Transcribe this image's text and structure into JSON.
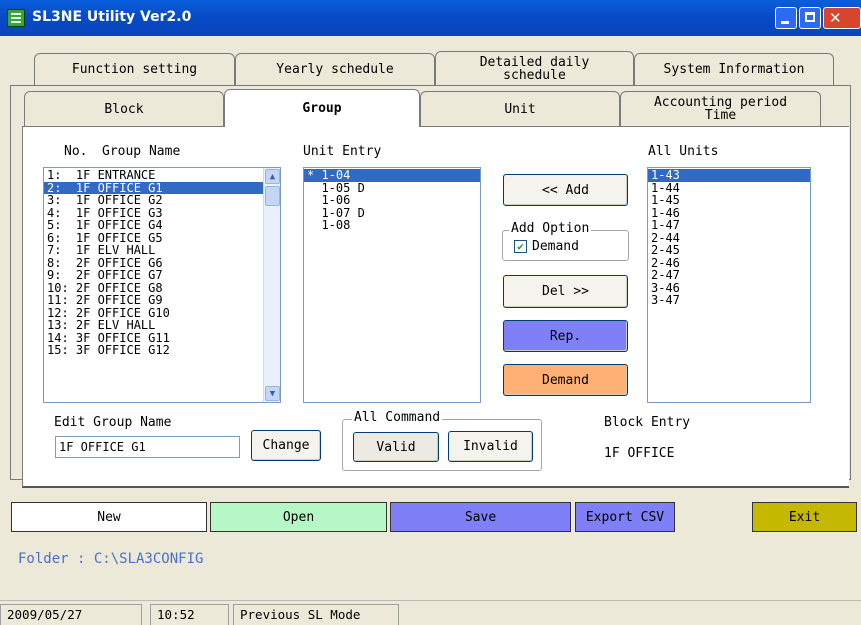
{
  "window": {
    "title": "SL3NE Utility Ver2.0"
  },
  "tabs_row1": [
    "Function setting",
    "Yearly schedule",
    "Detailed daily\nschedule",
    "System Information"
  ],
  "tabs_row2": [
    "Block",
    "Group",
    "Unit",
    "Accounting period\nTime"
  ],
  "active_tab": "Group",
  "group_list": {
    "header_no": "No.",
    "header_name": "Group Name",
    "selected_index": 1,
    "items": [
      "1:  1F ENTRANCE",
      "2:  1F OFFICE G1",
      "3:  1F OFFICE G2",
      "4:  1F OFFICE G3",
      "5:  1F OFFICE G4",
      "6:  1F OFFICE G5",
      "7:  1F ELV HALL",
      "8:  2F OFFICE G6",
      "9:  2F OFFICE G7",
      "10: 2F OFFICE G8",
      "11: 2F OFFICE G9",
      "12: 2F OFFICE G10",
      "13: 2F ELV HALL",
      "14: 3F OFFICE G11",
      "15: 3F OFFICE G12"
    ]
  },
  "unit_entry": {
    "label": "Unit Entry",
    "items": [
      "* 1-04",
      "  1-05 D",
      "  1-06",
      "  1-07 D",
      "  1-08"
    ]
  },
  "all_units": {
    "label": "All Units",
    "items": [
      "1-43",
      "1-44",
      "1-45",
      "1-46",
      "1-47",
      "2-44",
      "2-45",
      "2-46",
      "2-47",
      "3-46",
      "3-47"
    ]
  },
  "actions": {
    "add": "<<  Add",
    "add_option_label": "Add Option",
    "demand_checkbox": "Demand",
    "demand_checked": true,
    "del": "Del  >>",
    "rep": "Rep.",
    "demand": "Demand"
  },
  "edit_group": {
    "label": "Edit Group Name",
    "value": "1F OFFICE G1",
    "change": "Change"
  },
  "all_command": {
    "label": "All Command",
    "valid": "Valid",
    "invalid": "Invalid"
  },
  "block_entry": {
    "label": "Block Entry",
    "value": "1F OFFICE"
  },
  "bottom_buttons": {
    "new": "New",
    "open": "Open",
    "save": "Save",
    "export": "Export CSV",
    "exit": "Exit"
  },
  "folder": "Folder : C:\\SLA3CONFIG",
  "status": {
    "date": "2009/05/27",
    "time": "10:52",
    "mode": "Previous SL Mode"
  },
  "colors": {
    "selection": "#316ac5",
    "rep_button": "#7f7ff7",
    "demand_button": "#ffb175",
    "open_button": "#b6f7c6",
    "save_button": "#7f7ff7",
    "export_button": "#7f7ff7",
    "exit_button": "#c4b800",
    "folder_text": "#4a6fd0"
  }
}
